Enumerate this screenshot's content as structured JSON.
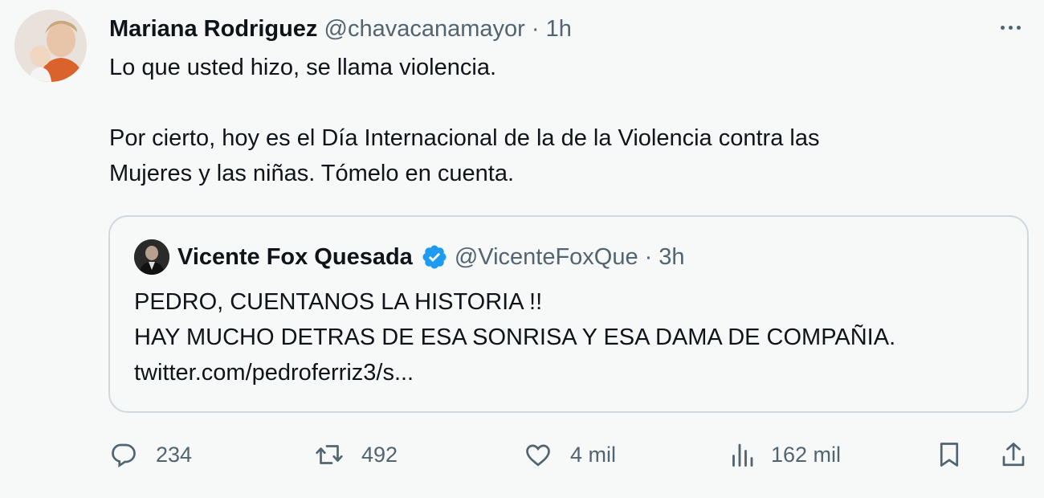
{
  "tweet": {
    "author": {
      "name": "Mariana Rodriguez",
      "handle": "@chavacanamayor",
      "separator": "·",
      "time": "1h"
    },
    "text": {
      "line1": "Lo que usted hizo, se llama violencia.",
      "line2": "Por cierto, hoy es el Día Internacional de la de la Violencia contra las",
      "line3": "Mujeres y las niñas. Tómelo en cuenta."
    },
    "quoted": {
      "author": {
        "name": "Vicente Fox Quesada",
        "handle": "@VicenteFoxQue",
        "separator": "·",
        "time": "3h"
      },
      "text": {
        "line1": "PEDRO, CUENTANOS LA HISTORIA !!",
        "line2": "HAY MUCHO DETRAS DE ESA SONRISA Y ESA DAMA DE COMPAÑIA.",
        "line3": "twitter.com/pedroferriz3/s..."
      }
    },
    "actions": {
      "replies": "234",
      "retweets": "492",
      "likes": "4 mil",
      "views": "162 mil"
    }
  },
  "colors": {
    "background": "#f7f9f9",
    "text": "#0f1419",
    "secondary": "#536471",
    "verified": "#1d9bf0",
    "border": "#cfd9de"
  }
}
